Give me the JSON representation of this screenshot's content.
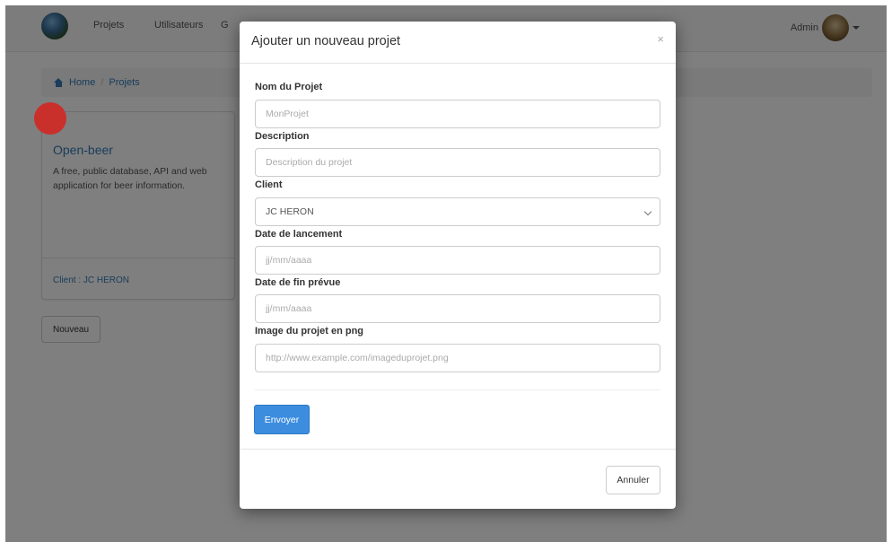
{
  "navbar": {
    "links": [
      "Projets",
      "Utilisateurs",
      "G"
    ],
    "user_label": "Admin"
  },
  "breadcrumb": {
    "home": "Home",
    "separator": "/",
    "current": "Projets"
  },
  "project_card": {
    "title": "Open-beer",
    "description": "A free, public database, API and web application for beer information.",
    "client": "Client : JC HERON"
  },
  "new_button_label": "Nouveau",
  "modal": {
    "title": "Ajouter un nouveau projet",
    "close_symbol": "×",
    "fields": {
      "name_label": "Nom du Projet",
      "name_placeholder": "MonProjet",
      "description_label": "Description",
      "description_placeholder": "Description du projet",
      "client_label": "Client",
      "client_value": "JC HERON",
      "start_date_label": "Date de lancement",
      "start_date_placeholder": "jj/mm/aaaa",
      "end_date_label": "Date de fin prévue",
      "end_date_placeholder": "jj/mm/aaaa",
      "image_label": "Image du projet en png",
      "image_placeholder": "http://www.example.com/imageduprojet.png"
    },
    "submit_label": "Envoyer",
    "cancel_label": "Annuler"
  },
  "colors": {
    "primary": "#3c8dde",
    "link": "#337ab7",
    "card_dot": "#c9302c"
  }
}
